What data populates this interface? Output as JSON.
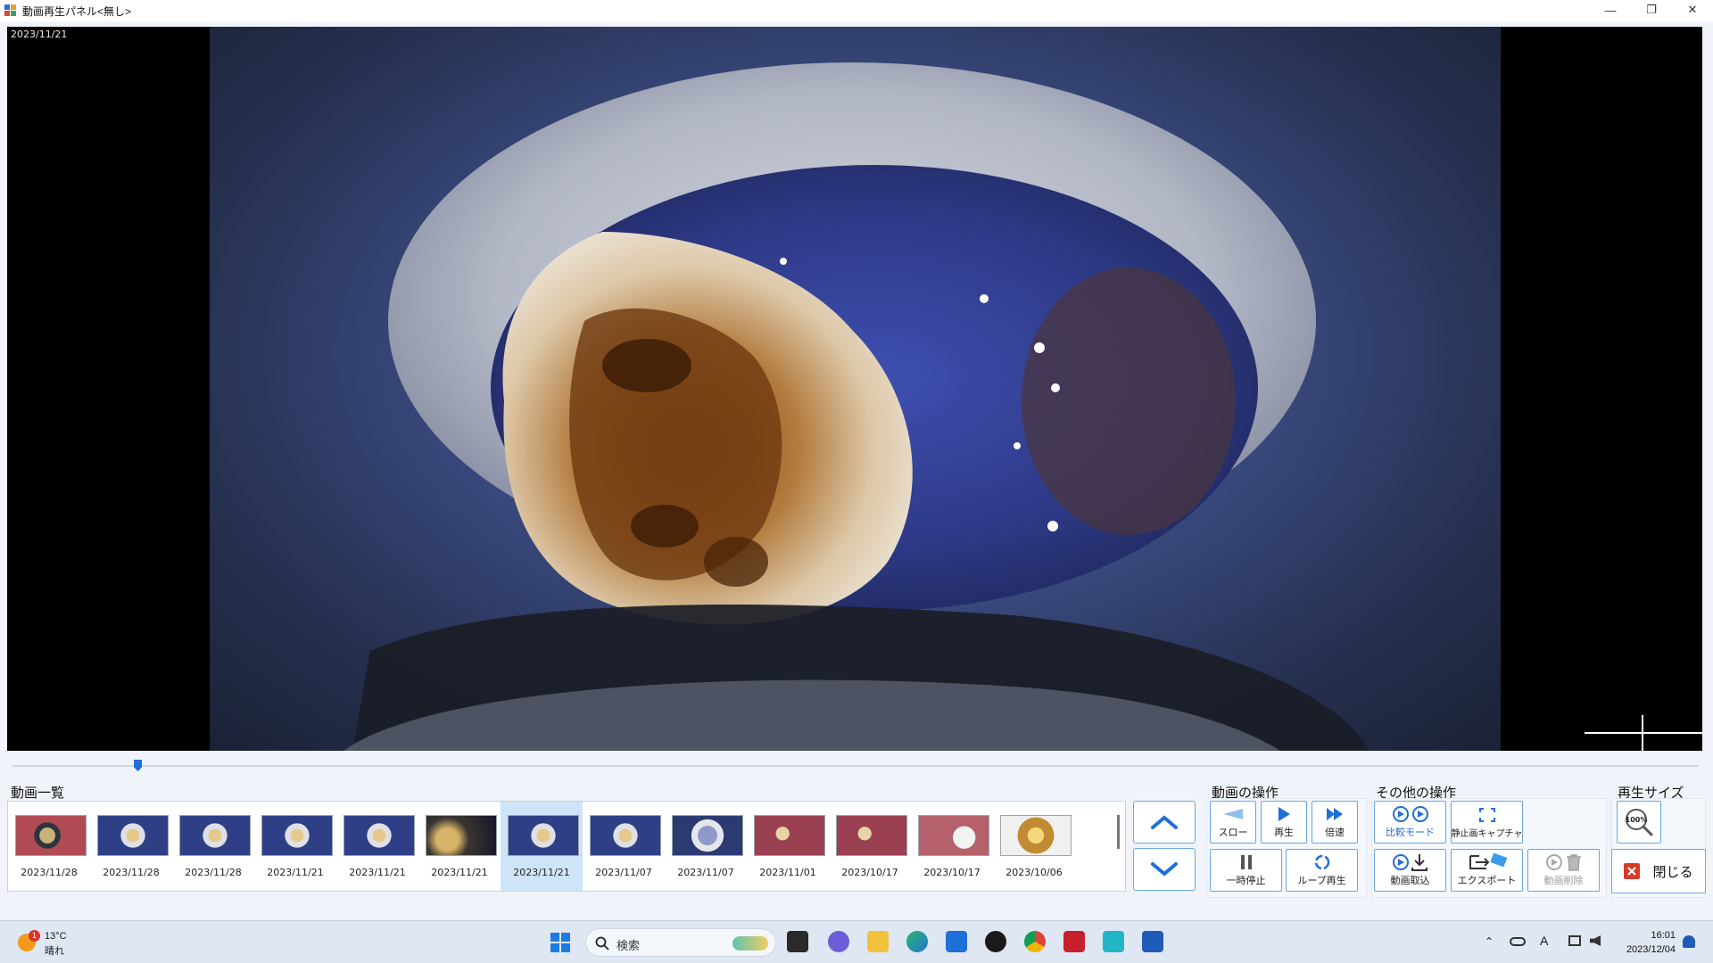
{
  "window": {
    "title": "動画再生パネル<無し>",
    "controls": {
      "minimize": "—",
      "restore": "❐",
      "close": "✕"
    }
  },
  "video": {
    "overlay_date": "2023/11/21",
    "seek_progress": 0.072
  },
  "video_list": {
    "label": "動画一覧",
    "selected_index": 6,
    "thumbnails": [
      {
        "date": "2023/11/28",
        "scene": "tooth-pink"
      },
      {
        "date": "2023/11/28",
        "scene": "tooth-blue"
      },
      {
        "date": "2023/11/28",
        "scene": "tooth-blue"
      },
      {
        "date": "2023/11/21",
        "scene": "tooth-blue"
      },
      {
        "date": "2023/11/21",
        "scene": "tooth-blue"
      },
      {
        "date": "2023/11/21",
        "scene": "dark-blur"
      },
      {
        "date": "2023/11/21",
        "scene": "tooth-blue"
      },
      {
        "date": "2023/11/07",
        "scene": "tooth-blue"
      },
      {
        "date": "2023/11/07",
        "scene": "ring-blue"
      },
      {
        "date": "2023/11/01",
        "scene": "gum-pink"
      },
      {
        "date": "2023/10/17",
        "scene": "gum-pink"
      },
      {
        "date": "2023/10/17",
        "scene": "gum-white"
      },
      {
        "date": "2023/10/06",
        "scene": "tooth-gold"
      }
    ]
  },
  "video_ops": {
    "label": "動画の操作",
    "slow": "スロー",
    "play": "再生",
    "fast": "倍速",
    "pause": "一時停止",
    "loop": "ループ再生"
  },
  "other_ops": {
    "label": "その他の操作",
    "compare_mode": "比較モード",
    "still_capture": "静止画キャプチャ",
    "video_import": "動画取込",
    "export": "エクスポート",
    "video_delete": "動画削除"
  },
  "playback_size": {
    "label": "再生サイズ",
    "zoom_badge": "100%",
    "close": "閉じる"
  },
  "taskbar": {
    "weather_temp": "13°C",
    "weather_desc": "晴れ",
    "weather_badge": "1",
    "search_placeholder": "検索",
    "time": "16:01",
    "date": "2023/12/04",
    "ime": "A"
  },
  "colors": {
    "accent": "#1f6fd8",
    "button_border": "#6aa7e0",
    "selected_thumb": "#cfe4f8"
  }
}
